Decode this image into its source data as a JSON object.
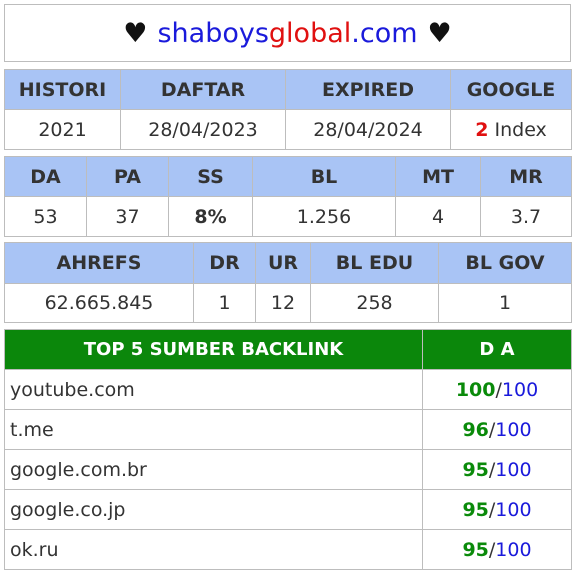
{
  "header": {
    "heart_left": "♥",
    "brand_part1": "shaboys",
    "brand_part2": "global",
    "brand_part3": ".com",
    "heart_right": "♥"
  },
  "registration": {
    "headers": [
      "HISTORI",
      "DAFTAR",
      "EXPIRED",
      "GOOGLE"
    ],
    "historI": "2021",
    "daftar": "28/04/2023",
    "expired": "28/04/2024",
    "google_count": "2",
    "google_suffix": "Index"
  },
  "metrics": {
    "headers": [
      "DA",
      "PA",
      "SS",
      "BL",
      "MT",
      "MR"
    ],
    "da": "53",
    "pa": "37",
    "ss": "8%",
    "bl": "1.256",
    "mt": "4",
    "mr": "3.7"
  },
  "ahrefs": {
    "headers": [
      "AHREFS",
      "DR",
      "UR",
      "BL EDU",
      "BL GOV"
    ],
    "ahrefs": "62.665.845",
    "dr": "1",
    "ur": "12",
    "bl_edu": "258",
    "bl_gov": "1"
  },
  "backlinks": {
    "header_source": "TOP 5 SUMBER BACKLINK",
    "header_da": "D A",
    "separator": "/",
    "rows": [
      {
        "site": "youtube.com",
        "da": "100",
        "max": "100"
      },
      {
        "site": "t.me",
        "da": "96",
        "max": "100"
      },
      {
        "site": "google.com.br",
        "da": "95",
        "max": "100"
      },
      {
        "site": "google.co.jp",
        "da": "95",
        "max": "100"
      },
      {
        "site": "ok.ru",
        "da": "95",
        "max": "100"
      }
    ]
  },
  "colors": {
    "header_blue": "#a9c4f5",
    "header_green": "#0b870b",
    "brand_blue": "#1a1adb",
    "brand_red": "#e01010",
    "value_green": "#0a8a0a"
  }
}
